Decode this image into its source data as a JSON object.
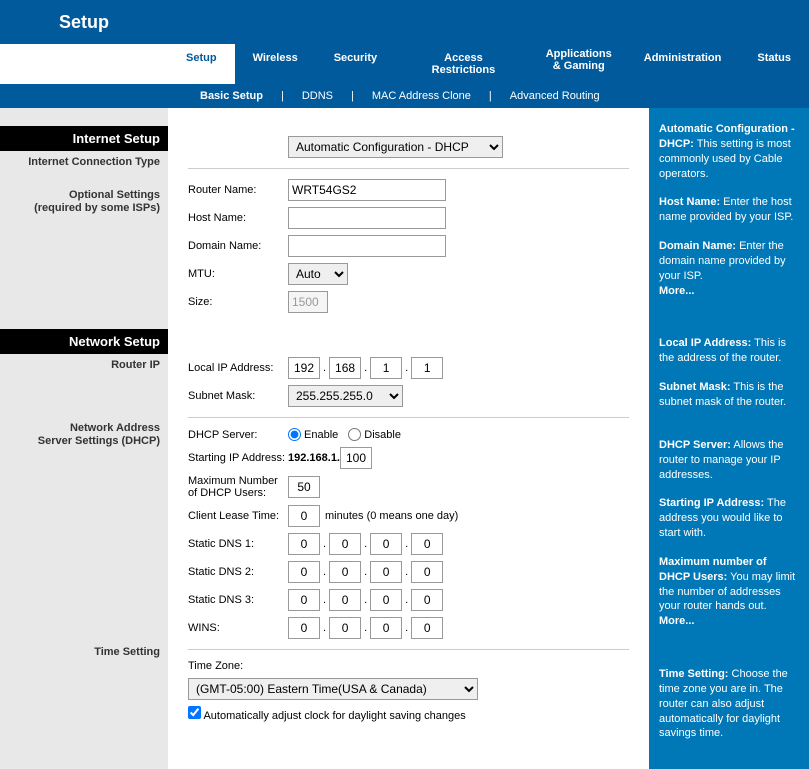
{
  "header": {
    "title": "Setup"
  },
  "tabs": {
    "setup": "Setup",
    "wireless": "Wireless",
    "security": "Security",
    "access": "Access Restrictions",
    "apps1": "Applications",
    "apps2": "& Gaming",
    "admin": "Administration",
    "status": "Status"
  },
  "subnav": {
    "basic": "Basic Setup",
    "ddns": "DDNS",
    "mac": "MAC Address Clone",
    "adv": "Advanced Routing"
  },
  "sections": {
    "internet": "Internet Setup",
    "conntype": "Internet Connection Type",
    "optional1": "Optional Settings",
    "optional2": "(required by some ISPs)",
    "network": "Network Setup",
    "routerip": "Router IP",
    "dhcp_h1": "Network Address",
    "dhcp_h2": "Server Settings (DHCP)",
    "time": "Time Setting"
  },
  "labels": {
    "connselect": "Automatic Configuration - DHCP",
    "router_name": "Router Name:",
    "host_name": "Host Name:",
    "domain_name": "Domain Name:",
    "mtu": "MTU:",
    "mtu_auto": "Auto",
    "size": "Size:",
    "local_ip": "Local IP Address:",
    "subnet": "Subnet Mask:",
    "subnet_val": "255.255.255.0",
    "dhcp_server": "DHCP Server:",
    "enable": "Enable",
    "disable": "Disable",
    "start_ip": "Starting IP Address:",
    "start_ip_prefix": "192.168.1.",
    "max_users1": "Maximum Number",
    "max_users2": "of  DHCP Users:",
    "lease": "Client Lease Time:",
    "lease_hint": "minutes (0 means one day)",
    "dns1": "Static DNS 1:",
    "dns2": "Static DNS 2:",
    "dns3": "Static DNS 3:",
    "wins": "WINS:",
    "tz": "Time Zone:",
    "tz_val": "(GMT-05:00) Eastern Time(USA & Canada)",
    "dst": "Automatically adjust clock for daylight saving changes"
  },
  "values": {
    "router_name": "WRT54GS2",
    "host_name": "",
    "domain_name": "",
    "size": "1500",
    "ip": [
      "192",
      "168",
      "1",
      "1"
    ],
    "start_ip_last": "100",
    "max_users": "50",
    "lease": "0",
    "dns1": [
      "0",
      "0",
      "0",
      "0"
    ],
    "dns2": [
      "0",
      "0",
      "0",
      "0"
    ],
    "dns3": [
      "0",
      "0",
      "0",
      "0"
    ],
    "wins": [
      "0",
      "0",
      "0",
      "0"
    ]
  },
  "help": {
    "h1b": "Automatic Configuration - DHCP:",
    "h1": " This setting is most commonly used by Cable operators.",
    "h2b": "Host Name:",
    "h2": " Enter the host name provided by your ISP.",
    "h3b": "Domain Name:",
    "h3": " Enter the domain name provided by your ISP.",
    "more": "More...",
    "h4b": "Local IP Address:",
    "h4": " This is the address of the router.",
    "h5b": "Subnet Mask:",
    "h5": " This is the subnet mask of the router.",
    "h6b": "DHCP Server:",
    "h6": " Allows the router to manage your IP addresses.",
    "h7b": "Starting IP Address:",
    "h7": " The address you would like to start with.",
    "h8b": "Maximum number of DHCP Users:",
    "h8": " You may limit the number of addresses your router hands out.",
    "h9b": "Time Setting:",
    "h9": " Choose the time zone you are in. The router can also adjust automatically for daylight savings time."
  }
}
